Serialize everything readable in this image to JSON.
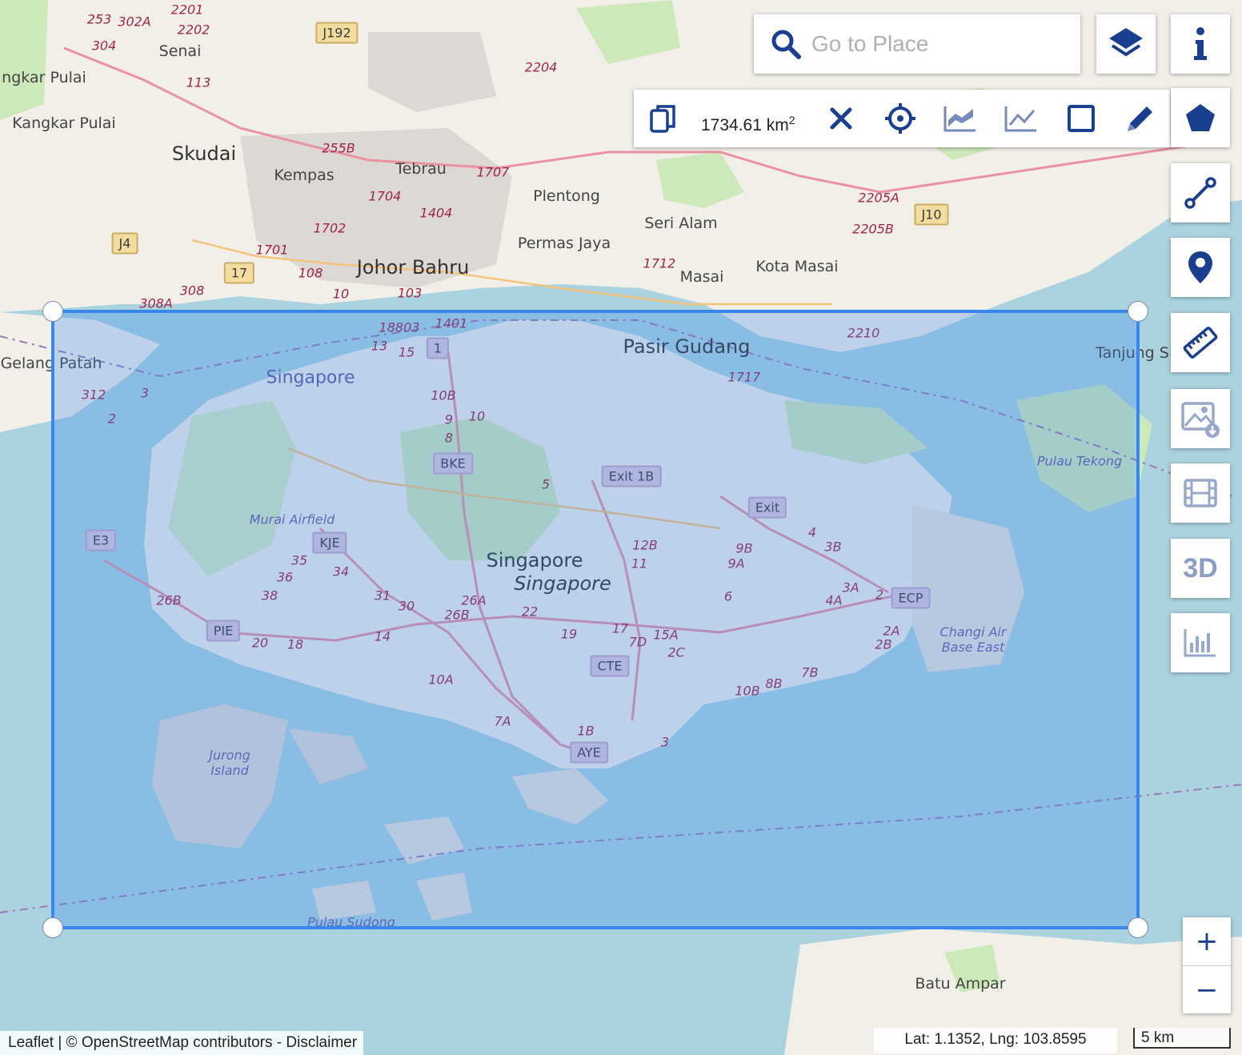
{
  "search": {
    "placeholder": "Go to Place"
  },
  "measure": {
    "area_value": "1734.61 km",
    "area_unit_sup": "2"
  },
  "toolbar_icons": [
    "copy-icon",
    "close-icon",
    "crosshair-icon",
    "area-chart-icon",
    "line-chart-icon",
    "square-icon",
    "pencil-icon"
  ],
  "side_buttons": [
    "layers-icon",
    "info-icon",
    "polygon-icon",
    "polyline-icon",
    "marker-icon",
    "ruler-icon",
    "image-download-icon",
    "film-icon",
    "3d-button",
    "bar-chart-icon"
  ],
  "three_d_label": "3D",
  "zoom": {
    "in": "+",
    "out": "−"
  },
  "attribution": "Leaflet | © OpenStreetMap contributors - Disclaimer",
  "coords": "Lat: 1.1352, Lng: 103.8595",
  "scale": "5 km",
  "colors": {
    "selection": "#3a86f0",
    "icon": "#1b3f8f",
    "water": "#aad3df",
    "land": "#f2efe9"
  },
  "map": {
    "places": [
      {
        "name": "Skudai",
        "cls": "city"
      },
      {
        "name": "Johor Bahru",
        "cls": "city"
      },
      {
        "name": "Pasir Gudang",
        "cls": "city"
      },
      {
        "name": "Singapore",
        "cls": "city"
      },
      {
        "name": "Singapore",
        "cls": "city italic"
      },
      {
        "name": "Senai",
        "cls": "town"
      },
      {
        "name": "Kangkar Pulai",
        "cls": "town"
      },
      {
        "name": "ngkar Pulai",
        "cls": "town"
      },
      {
        "name": "Kempas",
        "cls": "town"
      },
      {
        "name": "Tebrau",
        "cls": "town"
      },
      {
        "name": "Plentong",
        "cls": "town"
      },
      {
        "name": "Seri Alam",
        "cls": "town"
      },
      {
        "name": "Permas Jaya",
        "cls": "town"
      },
      {
        "name": "Masai",
        "cls": "town"
      },
      {
        "name": "Kota Masai",
        "cls": "town"
      },
      {
        "name": "Tanjung S",
        "cls": "town"
      },
      {
        "name": "Gelang Patah",
        "cls": "town"
      },
      {
        "name": "Batu Ampar",
        "cls": "town"
      },
      {
        "name": "Singapore",
        "cls": "water"
      },
      {
        "name": "Murai Airfield",
        "cls": "italic"
      },
      {
        "name": "Pulau Tekong",
        "cls": "italic"
      },
      {
        "name": "Jurong Island",
        "cls": "italic"
      },
      {
        "name": "Changi Air Base East",
        "cls": "italic"
      },
      {
        "name": "Pulau Sudong",
        "cls": "italic"
      }
    ],
    "shields": [
      "J192",
      "J4",
      "17",
      "J10",
      "1",
      "BKE",
      "Exit 1B",
      "Exit",
      "KJE",
      "E3",
      "PIE",
      "CTE",
      "AYE",
      "ECP"
    ],
    "road_numbers": [
      "253",
      "302A",
      "2201",
      "2202",
      "304",
      "113",
      "255B",
      "1707",
      "1704",
      "1404",
      "1702",
      "1701",
      "108",
      "10",
      "103",
      "308",
      "308A",
      "2204",
      "2205A",
      "2205B",
      "1712",
      "2210",
      "1717",
      "18803",
      "1401",
      "13",
      "15",
      "10B",
      "9",
      "8",
      "10",
      "5",
      "12B",
      "11",
      "9B",
      "9A",
      "4",
      "3B",
      "3A",
      "4A",
      "6",
      "26B",
      "36",
      "38",
      "35",
      "34",
      "31",
      "30",
      "26A",
      "26B",
      "22",
      "19",
      "17",
      "7D",
      "15A",
      "2C",
      "20",
      "18",
      "14",
      "10A",
      "7A",
      "1B",
      "3",
      "2",
      "2A",
      "2B",
      "7B",
      "8B",
      "10B",
      "312",
      "3",
      "2"
    ]
  }
}
